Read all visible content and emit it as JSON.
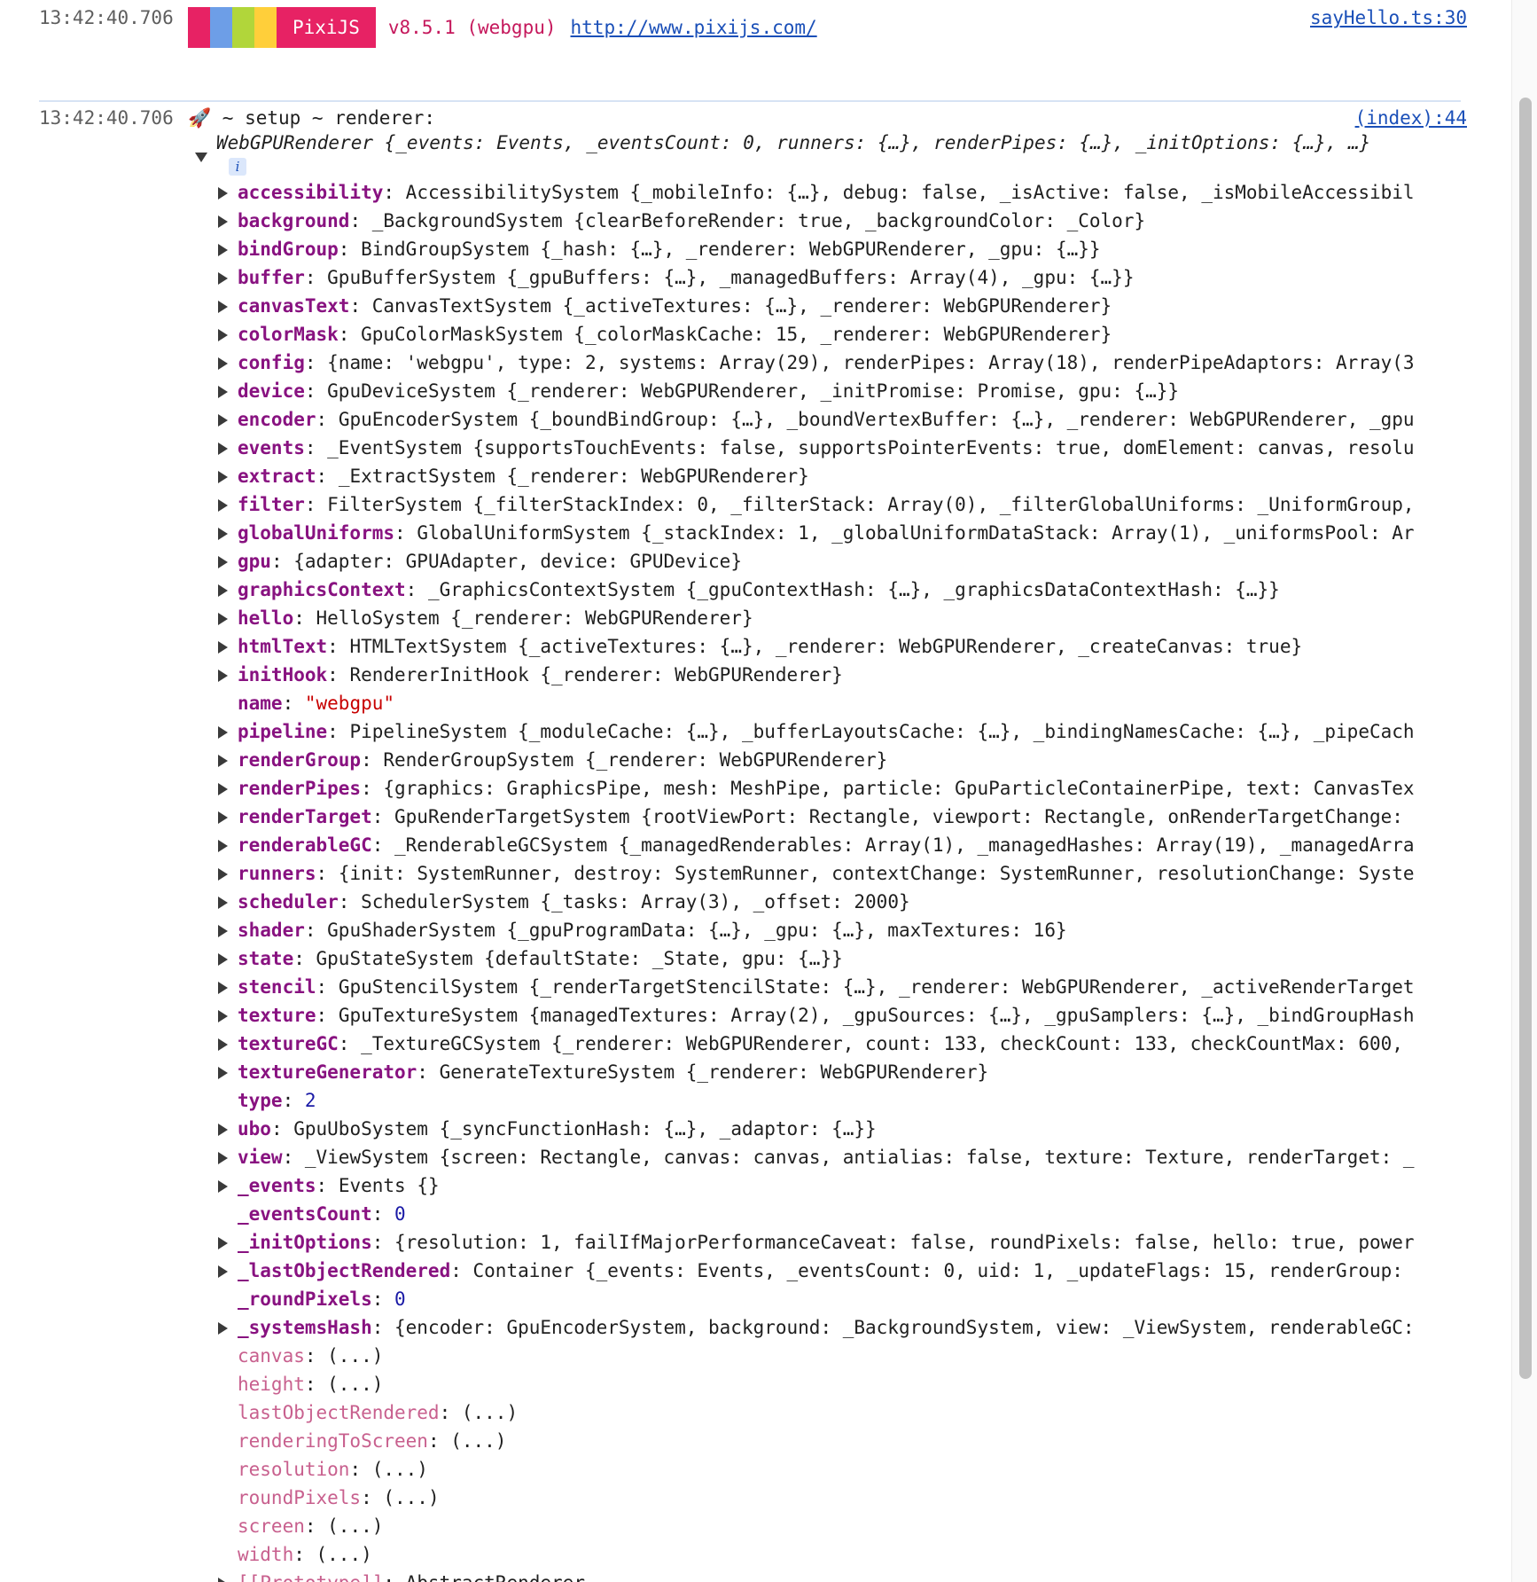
{
  "message1": {
    "timestamp": "13:42:40.706",
    "banner_colors": [
      "#e72264",
      "#6d9ee7",
      "#b1d63a",
      "#ffcf3a"
    ],
    "pixi_label": "PixiJS",
    "version_text": "v8.5.1 (webgpu)",
    "url": "http://www.pixijs.com/",
    "source": "sayHello.ts:30"
  },
  "message2": {
    "timestamp": "13:42:40.706",
    "label": "🚀 ~ setup ~ renderer:",
    "source": "(index):44",
    "object_summary": "WebGPURenderer {_events: Events, _eventsCount: 0, runners: {…}, renderPipes: {…}, _initOptions: {…}, …}",
    "info_badge": "i"
  },
  "properties": [
    {
      "key": "accessibility",
      "expandable": true,
      "value": "AccessibilitySystem {_mobileInfo: {…}, debug: false, _isActive: false, _isMobileAccessibil"
    },
    {
      "key": "background",
      "expandable": true,
      "value": "_BackgroundSystem {clearBeforeRender: true, _backgroundColor: _Color}"
    },
    {
      "key": "bindGroup",
      "expandable": true,
      "value": "BindGroupSystem {_hash: {…}, _renderer: WebGPURenderer, _gpu: {…}}"
    },
    {
      "key": "buffer",
      "expandable": true,
      "value": "GpuBufferSystem {_gpuBuffers: {…}, _managedBuffers: Array(4), _gpu: {…}}"
    },
    {
      "key": "canvasText",
      "expandable": true,
      "value": "CanvasTextSystem {_activeTextures: {…}, _renderer: WebGPURenderer}"
    },
    {
      "key": "colorMask",
      "expandable": true,
      "value": "GpuColorMaskSystem {_colorMaskCache: 15, _renderer: WebGPURenderer}"
    },
    {
      "key": "config",
      "expandable": true,
      "value": "{name: 'webgpu', type: 2, systems: Array(29), renderPipes: Array(18), renderPipeAdaptors: Array(3"
    },
    {
      "key": "device",
      "expandable": true,
      "value": "GpuDeviceSystem {_renderer: WebGPURenderer, _initPromise: Promise, gpu: {…}}"
    },
    {
      "key": "encoder",
      "expandable": true,
      "value": "GpuEncoderSystem {_boundBindGroup: {…}, _boundVertexBuffer: {…}, _renderer: WebGPURenderer, _gpu"
    },
    {
      "key": "events",
      "expandable": true,
      "value": "_EventSystem {supportsTouchEvents: false, supportsPointerEvents: true, domElement: canvas, resolu"
    },
    {
      "key": "extract",
      "expandable": true,
      "value": "_ExtractSystem {_renderer: WebGPURenderer}"
    },
    {
      "key": "filter",
      "expandable": true,
      "value": "FilterSystem {_filterStackIndex: 0, _filterStack: Array(0), _filterGlobalUniforms: _UniformGroup,"
    },
    {
      "key": "globalUniforms",
      "expandable": true,
      "value": "GlobalUniformSystem {_stackIndex: 1, _globalUniformDataStack: Array(1), _uniformsPool: Ar"
    },
    {
      "key": "gpu",
      "expandable": true,
      "value": "{adapter: GPUAdapter, device: GPUDevice}"
    },
    {
      "key": "graphicsContext",
      "expandable": true,
      "value": "_GraphicsContextSystem {_gpuContextHash: {…}, _graphicsDataContextHash: {…}}"
    },
    {
      "key": "hello",
      "expandable": true,
      "value": "HelloSystem {_renderer: WebGPURenderer}"
    },
    {
      "key": "htmlText",
      "expandable": true,
      "value": "HTMLTextSystem {_activeTextures: {…}, _renderer: WebGPURenderer, _createCanvas: true}"
    },
    {
      "key": "initHook",
      "expandable": true,
      "value": "RendererInitHook {_renderer: WebGPURenderer}"
    },
    {
      "key": "name",
      "expandable": false,
      "value": "\"webgpu\""
    },
    {
      "key": "pipeline",
      "expandable": true,
      "value": "PipelineSystem {_moduleCache: {…}, _bufferLayoutsCache: {…}, _bindingNamesCache: {…}, _pipeCach"
    },
    {
      "key": "renderGroup",
      "expandable": true,
      "value": "RenderGroupSystem {_renderer: WebGPURenderer}"
    },
    {
      "key": "renderPipes",
      "expandable": true,
      "value": "{graphics: GraphicsPipe, mesh: MeshPipe, particle: GpuParticleContainerPipe, text: CanvasTex"
    },
    {
      "key": "renderTarget",
      "expandable": true,
      "value": "GpuRenderTargetSystem {rootViewPort: Rectangle, viewport: Rectangle, onRenderTargetChange:"
    },
    {
      "key": "renderableGC",
      "expandable": true,
      "value": "_RenderableGCSystem {_managedRenderables: Array(1), _managedHashes: Array(19), _managedArra"
    },
    {
      "key": "runners",
      "expandable": true,
      "value": "{init: SystemRunner, destroy: SystemRunner, contextChange: SystemRunner, resolutionChange: Syste"
    },
    {
      "key": "scheduler",
      "expandable": true,
      "value": "SchedulerSystem {_tasks: Array(3), _offset: 2000}"
    },
    {
      "key": "shader",
      "expandable": true,
      "value": "GpuShaderSystem {_gpuProgramData: {…}, _gpu: {…}, maxTextures: 16}"
    },
    {
      "key": "state",
      "expandable": true,
      "value": "GpuStateSystem {defaultState: _State, gpu: {…}}"
    },
    {
      "key": "stencil",
      "expandable": true,
      "value": "GpuStencilSystem {_renderTargetStencilState: {…}, _renderer: WebGPURenderer, _activeRenderTarget"
    },
    {
      "key": "texture",
      "expandable": true,
      "value": "GpuTextureSystem {managedTextures: Array(2), _gpuSources: {…}, _gpuSamplers: {…}, _bindGroupHash"
    },
    {
      "key": "textureGC",
      "expandable": true,
      "value": "_TextureGCSystem {_renderer: WebGPURenderer, count: 133, checkCount: 133, checkCountMax: 600,"
    },
    {
      "key": "textureGenerator",
      "expandable": true,
      "value": "GenerateTextureSystem {_renderer: WebGPURenderer}"
    },
    {
      "key": "type",
      "expandable": false,
      "value": "2"
    },
    {
      "key": "ubo",
      "expandable": true,
      "value": "GpuUboSystem {_syncFunctionHash: {…}, _adaptor: {…}}"
    },
    {
      "key": "view",
      "expandable": true,
      "value": "_ViewSystem {screen: Rectangle, canvas: canvas, antialias: false, texture: Texture, renderTarget: _"
    },
    {
      "key": "_events",
      "expandable": true,
      "value": "Events {}"
    },
    {
      "key": "_eventsCount",
      "expandable": false,
      "value": "0"
    },
    {
      "key": "_initOptions",
      "expandable": true,
      "value": "{resolution: 1, failIfMajorPerformanceCaveat: false, roundPixels: false, hello: true, power"
    },
    {
      "key": "_lastObjectRendered",
      "expandable": true,
      "value": "Container {_events: Events, _eventsCount: 0, uid: 1, _updateFlags: 15, renderGroup:"
    },
    {
      "key": "_roundPixels",
      "expandable": false,
      "value": "0"
    },
    {
      "key": "_systemsHash",
      "expandable": true,
      "value": "{encoder: GpuEncoderSystem, background: _BackgroundSystem, view: _ViewSystem, renderableGC:"
    },
    {
      "key": "canvas",
      "expandable": false,
      "dim": true,
      "value": "(...)"
    },
    {
      "key": "height",
      "expandable": false,
      "dim": true,
      "value": "(...)"
    },
    {
      "key": "lastObjectRendered",
      "expandable": false,
      "dim": true,
      "value": "(...)"
    },
    {
      "key": "renderingToScreen",
      "expandable": false,
      "dim": true,
      "value": "(...)"
    },
    {
      "key": "resolution",
      "expandable": false,
      "dim": true,
      "value": "(...)"
    },
    {
      "key": "roundPixels",
      "expandable": false,
      "dim": true,
      "value": "(...)"
    },
    {
      "key": "screen",
      "expandable": false,
      "dim": true,
      "value": "(...)"
    },
    {
      "key": "width",
      "expandable": false,
      "dim": true,
      "value": "(...)"
    },
    {
      "key": "[[Prototype]]",
      "expandable": true,
      "dim": true,
      "value": "AbstractRenderer"
    }
  ]
}
